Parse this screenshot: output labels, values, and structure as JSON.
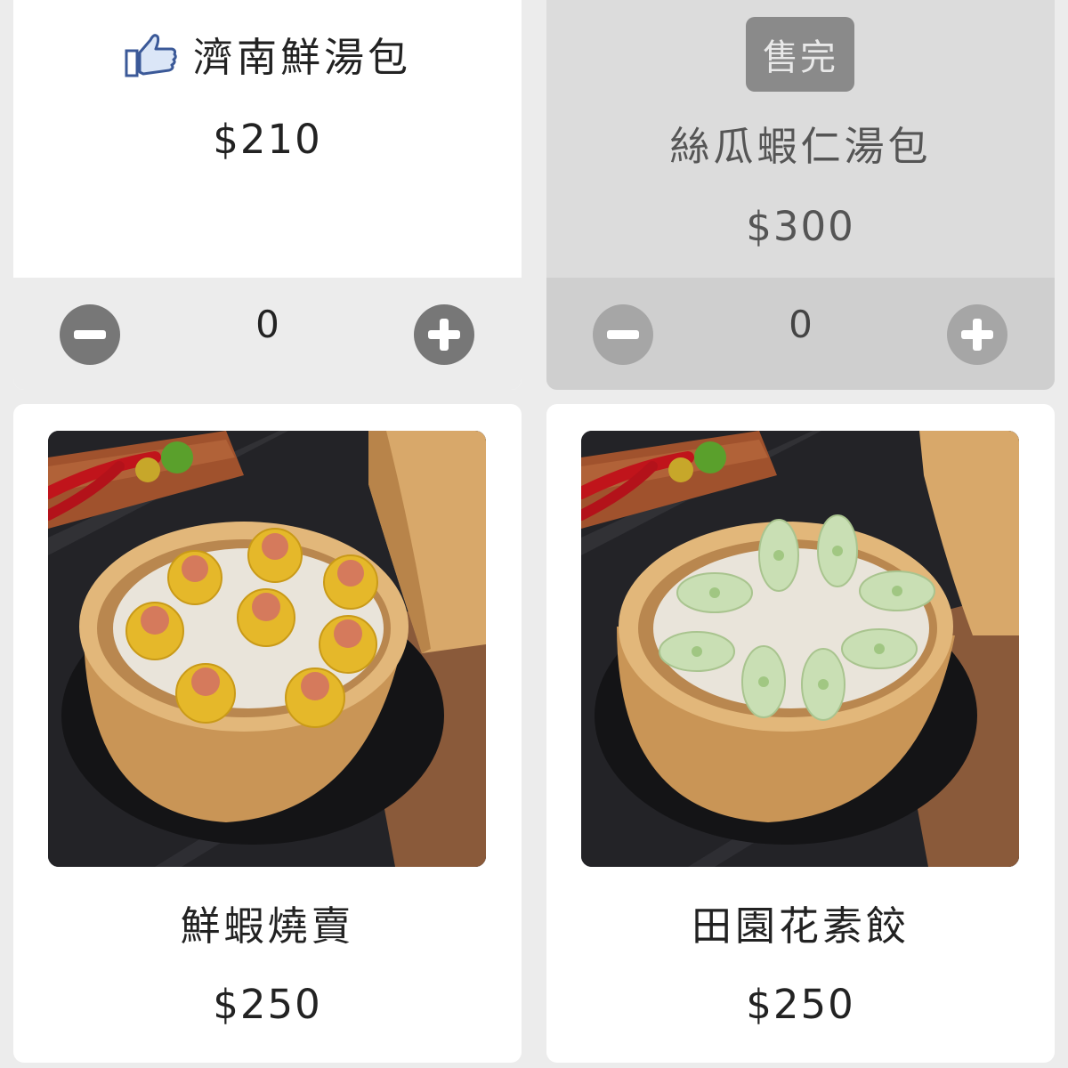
{
  "menu": {
    "items": [
      {
        "name": "濟南鮮湯包",
        "price": "$210",
        "quantity": "0",
        "featured": true,
        "sold_out": false
      },
      {
        "name": "絲瓜蝦仁湯包",
        "price": "$300",
        "quantity": "0",
        "featured": false,
        "sold_out": true,
        "sold_out_label": "售完"
      },
      {
        "name": "鮮蝦燒賣",
        "price": "$250",
        "featured": false,
        "sold_out": false,
        "photo": "shumai-steamer-photo"
      },
      {
        "name": "田園花素餃",
        "price": "$250",
        "featured": false,
        "sold_out": false,
        "photo": "veggie-dumpling-steamer-photo"
      }
    ]
  },
  "icons": {
    "featured": "thumbs-up-icon",
    "decrease": "minus-circle-icon",
    "increase": "plus-circle-icon"
  },
  "colors": {
    "card_bg": "#ffffff",
    "soldout_card_bg": "#dcdcdc",
    "qty_bar_bg": "#ececec",
    "button_gray": "#777777",
    "badge_gray": "#8a8a8a",
    "thumb_blue": "#3b5998"
  }
}
